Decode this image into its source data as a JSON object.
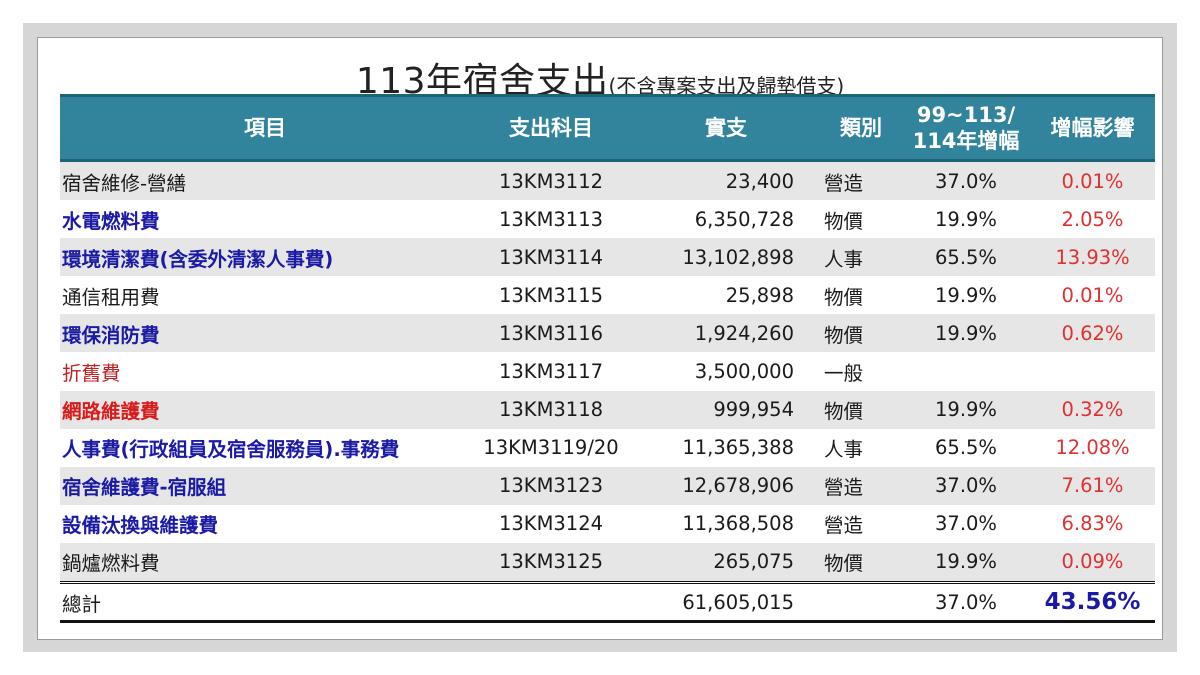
{
  "title": {
    "main": "113年宿舍支出",
    "sub": "(不含專案支出及歸墊借支)"
  },
  "headers": {
    "item": "項目",
    "code": "支出科目",
    "amount": "實支",
    "category": "類別",
    "rate_line1": "99~113/",
    "rate_line2": "114年增幅",
    "impact": "增幅影響"
  },
  "rows": [
    {
      "item": "宿舍維修-營繕",
      "code": "13KM3112",
      "amount": "23,400",
      "category": "營造",
      "rate": "37.0%",
      "impact": "0.01%",
      "style": "plain"
    },
    {
      "item": "水電燃料費",
      "code": "13KM3113",
      "amount": "6,350,728",
      "category": "物價",
      "rate": "19.9%",
      "impact": "2.05%",
      "style": "blue"
    },
    {
      "item": "環境清潔費(含委外清潔人事費)",
      "code": "13KM3114",
      "amount": "13,102,898",
      "category": "人事",
      "rate": "65.5%",
      "impact": "13.93%",
      "style": "blue"
    },
    {
      "item": "通信租用費",
      "code": "13KM3115",
      "amount": "25,898",
      "category": "物價",
      "rate": "19.9%",
      "impact": "0.01%",
      "style": "plain"
    },
    {
      "item": "環保消防費",
      "code": "13KM3116",
      "amount": "1,924,260",
      "category": "物價",
      "rate": "19.9%",
      "impact": "0.62%",
      "style": "blue"
    },
    {
      "item": "折舊費",
      "code": "13KM3117",
      "amount": "3,500,000",
      "category": "一般",
      "rate": "",
      "impact": "",
      "style": "redplain"
    },
    {
      "item": "網路維護費",
      "code": "13KM3118",
      "amount": "999,954",
      "category": "物價",
      "rate": "19.9%",
      "impact": "0.32%",
      "style": "red"
    },
    {
      "item": "人事費(行政組員及宿舍服務員).事務費",
      "code": "13KM3119/20",
      "amount": "11,365,388",
      "category": "人事",
      "rate": "65.5%",
      "impact": "12.08%",
      "style": "blue"
    },
    {
      "item": "宿舍維護費-宿服組",
      "code": "13KM3123",
      "amount": "12,678,906",
      "category": "營造",
      "rate": "37.0%",
      "impact": "7.61%",
      "style": "blue"
    },
    {
      "item": "設備汰換與維護費",
      "code": "13KM3124",
      "amount": "11,368,508",
      "category": "營造",
      "rate": "37.0%",
      "impact": "6.83%",
      "style": "blue"
    },
    {
      "item": "鍋爐燃料費",
      "code": "13KM3125",
      "amount": "265,075",
      "category": "物價",
      "rate": "19.9%",
      "impact": "0.09%",
      "style": "plain"
    }
  ],
  "total": {
    "item": "總計",
    "code": "",
    "amount": "61,605,015",
    "category": "",
    "rate": "37.0%",
    "impact": "43.56%"
  },
  "colors": {
    "header_bg": "#31849b",
    "band_grey": "#e6e6e6",
    "item_blue": "#1a1aa6",
    "item_red": "#d81c1c",
    "impact_red": "#e03030"
  }
}
